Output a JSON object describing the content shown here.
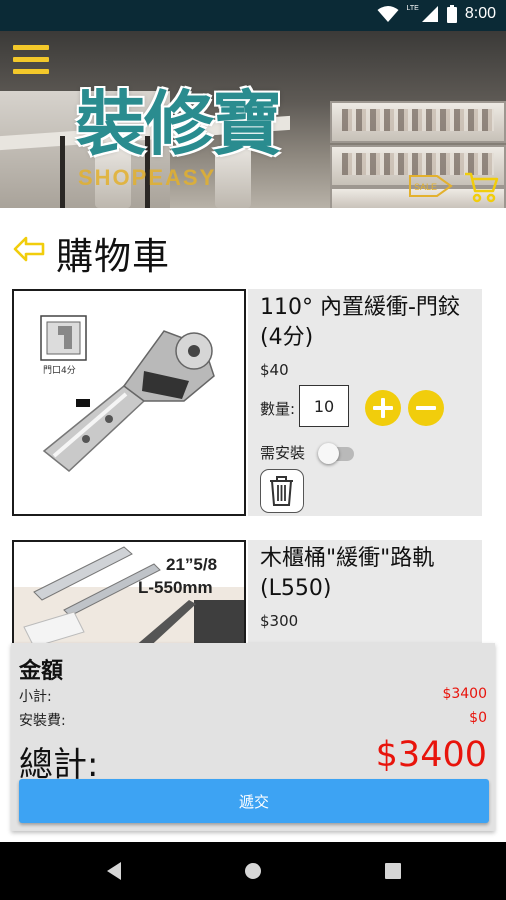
{
  "status_bar": {
    "time": "8:00",
    "network": "LTE"
  },
  "header": {
    "logo_text": "裝修寶",
    "logo_subtitle": "SHOPEASY",
    "sale_label": "SALE"
  },
  "page": {
    "title": "購物車"
  },
  "cart": {
    "items": [
      {
        "name": "110° 內置緩衝-門鉸(4分)",
        "price": "$40",
        "qty_label": "數量:",
        "quantity": "10",
        "install_label": "需安裝",
        "install_enabled": false,
        "image_badge": "門口4分"
      },
      {
        "name": "木櫃桶\"緩衝\"路軌(L550)",
        "price": "$300",
        "image_line1": "21”5/8",
        "image_line2": "L-550mm"
      }
    ]
  },
  "summary": {
    "title": "金額",
    "subtotal_label": "小計:",
    "subtotal_value": "$3400",
    "install_fee_label": "安裝費:",
    "install_fee_value": "$0",
    "total_label": "總計:",
    "total_value": "$3400",
    "submit_label": "遞交"
  },
  "colors": {
    "accent_yellow": "#f1cd0c",
    "submit_blue": "#3da3f3",
    "price_red": "#e8140c",
    "logo_teal": "#2a8c8f"
  },
  "icons": [
    "menu-icon",
    "sale-icon",
    "cart-icon",
    "back-arrow-icon",
    "plus-icon",
    "minus-icon",
    "trash-icon",
    "nav-back-icon",
    "nav-home-icon",
    "nav-recents-icon",
    "wifi-icon",
    "signal-icon",
    "battery-icon"
  ]
}
